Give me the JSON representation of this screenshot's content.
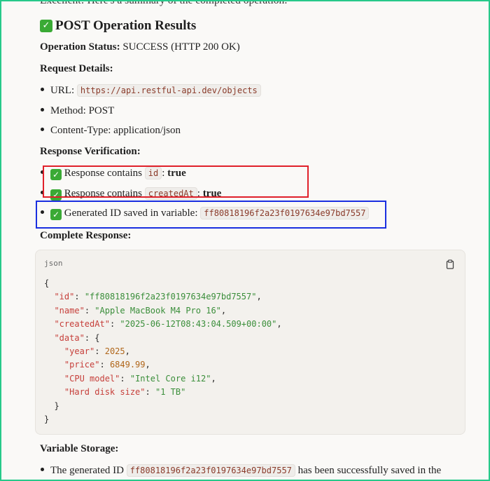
{
  "intro": "Excellent! Here's a summary of the completed operation:",
  "heading": "POST Operation Results",
  "status": {
    "label": "Operation Status:",
    "value": "SUCCESS (HTTP 200 OK)"
  },
  "request": {
    "title": "Request Details:",
    "url_label": "URL:",
    "url": "https://api.restful-api.dev/objects",
    "method": "Method: POST",
    "content_type": "Content-Type: application/json"
  },
  "verification": {
    "title": "Response Verification:",
    "item1_text": "Response contains",
    "item1_code": "id",
    "item1_result": "true",
    "item2_text": "Response contains",
    "item2_code": "createdAt",
    "item2_result": "true",
    "item3_text": "Generated ID saved in variable:",
    "item3_code": "ff80818196f2a23f0197634e97bd7557"
  },
  "response": {
    "title": "Complete Response:",
    "lang": "json",
    "json": {
      "id": "ff80818196f2a23f0197634e97bd7557",
      "name": "Apple MacBook M4 Pro 16",
      "createdAt": "2025-06-12T08:43:04.509+00:00",
      "data": {
        "year": 2025,
        "price": 6849.99,
        "CPU model": "Intel Core i12",
        "Hard disk size": "1 TB"
      }
    }
  },
  "storage": {
    "title": "Variable Storage:",
    "text_before": "The generated ID",
    "code": "ff80818196f2a23f0197634e97bd7557",
    "text_after": "has been successfully saved in the"
  },
  "icons": {
    "check": "check-mark-icon",
    "copy": "copy-icon"
  },
  "colors": {
    "check": "#3aaa35",
    "red_highlight": "#e0202a",
    "blue_highlight": "#1a2fe0",
    "frame": "#27c98a"
  }
}
